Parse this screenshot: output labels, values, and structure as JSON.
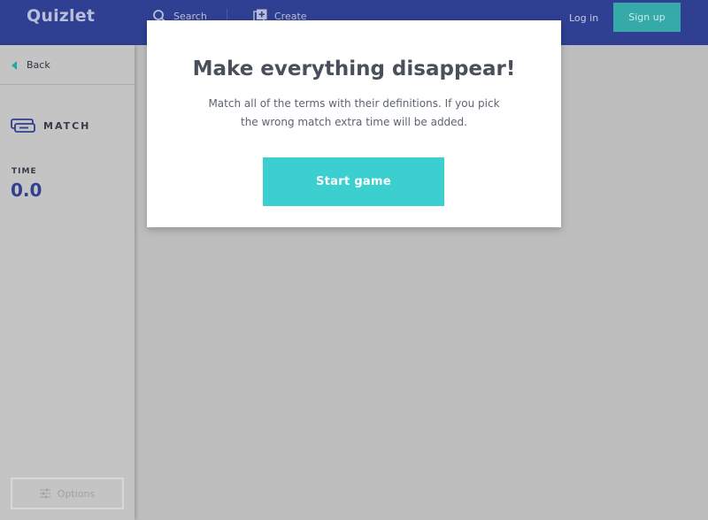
{
  "header": {
    "logo": "Quizlet",
    "search_label": "Search",
    "search_icon": "search-icon",
    "create_label": "Create",
    "create_icon": "add-square-icon",
    "login_label": "Log in",
    "signup_label": "Sign up",
    "bg_color": "#2f3f92",
    "signup_color": "#36a9a9"
  },
  "sidebar": {
    "back_label": "Back",
    "back_icon": "caret-left-icon",
    "mode_icon": "match-cards-icon",
    "mode_label": "MATCH",
    "time_label": "TIME",
    "time_value": "0.0",
    "options_label": "Options",
    "options_icon": "sliders-icon"
  },
  "modal": {
    "title": "Make everything disappear!",
    "description": "Match all of the terms with their definitions. If you pick the wrong match extra time will be added.",
    "start_label": "Start game",
    "start_color": "#3ccfcf"
  }
}
